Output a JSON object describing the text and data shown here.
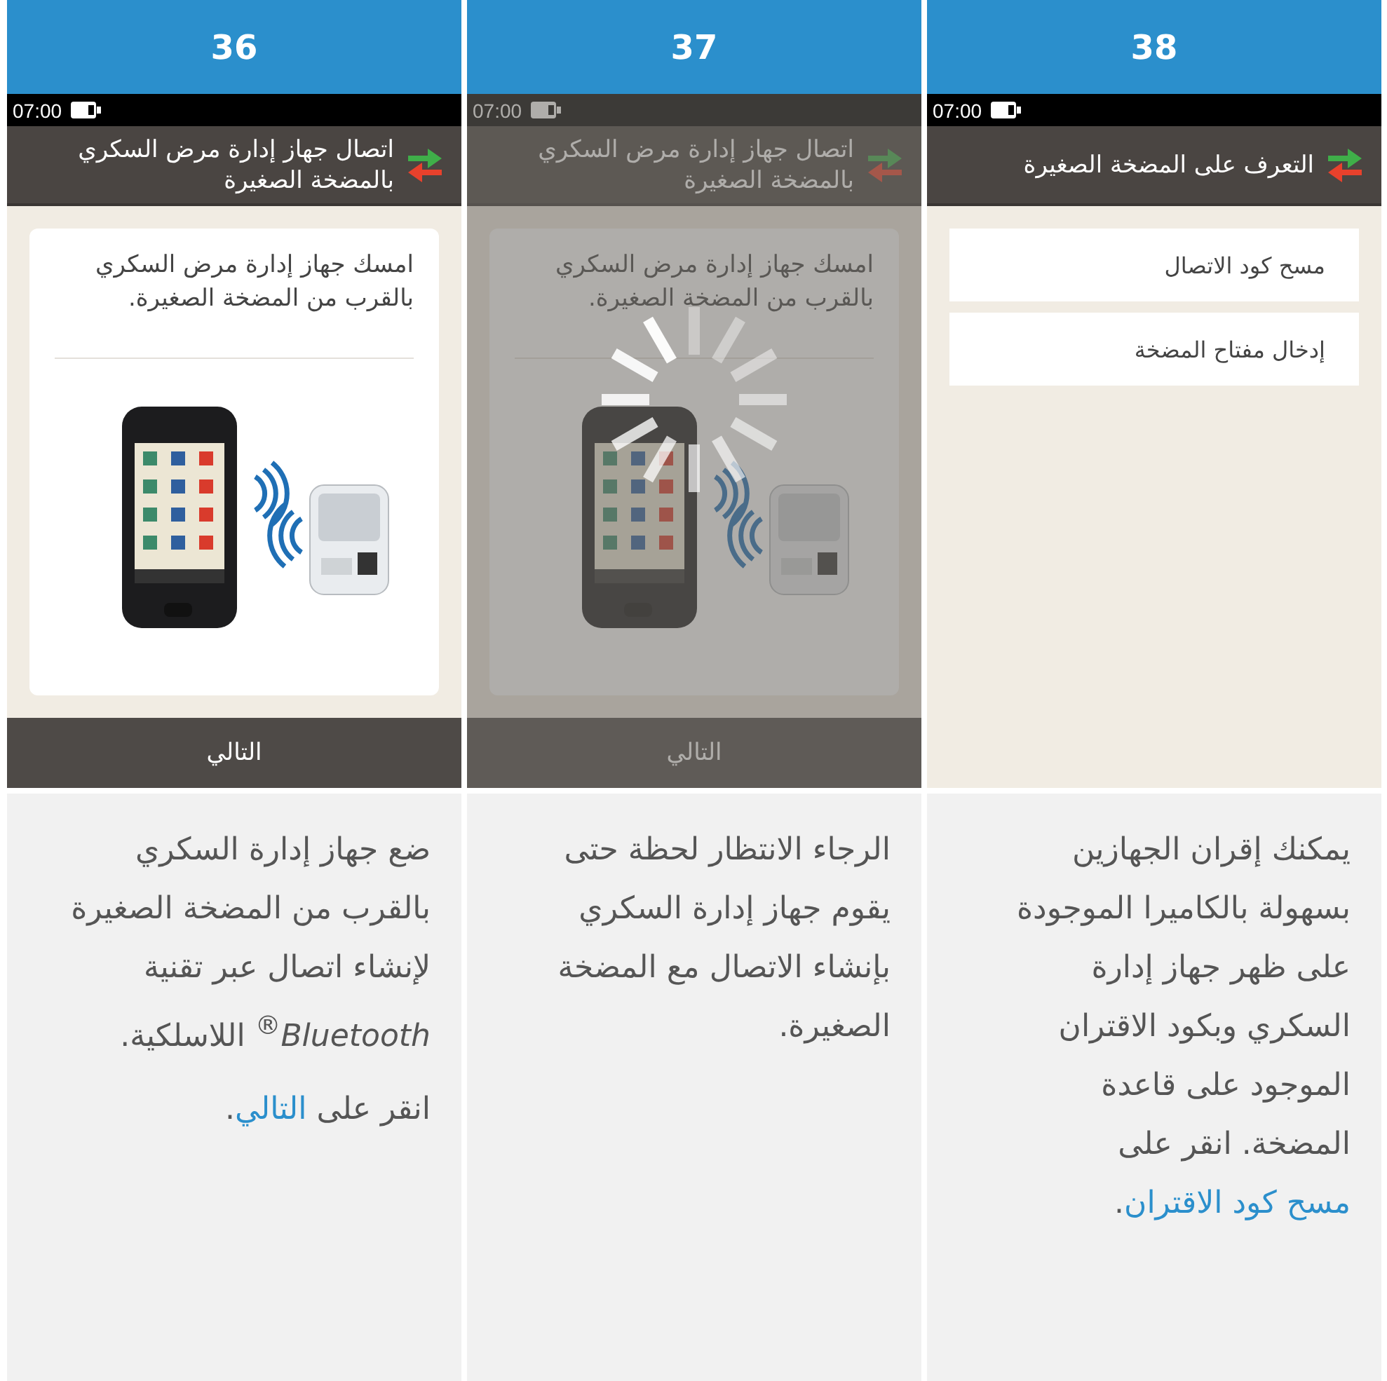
{
  "panels": [
    {
      "number": "38",
      "screen": {
        "time": "07:00",
        "title": "التعرف على المضخة الصغيرة",
        "kind": "menu",
        "busy": false,
        "menu_items": [
          "مسح كود الاتصال",
          "إدخال مفتاح المضخة"
        ]
      },
      "description": [
        [
          {
            "kind": "plain",
            "text": "يمكنك إقران الجهازين بسهولة بالكاميرا الموجودة على ظهر جهاز إدارة السكري وبكود الاقتران الموجود على قاعدة المضخة. انقر على "
          },
          {
            "kind": "link",
            "text": "مسح كود الاقتران"
          },
          {
            "kind": "plain",
            "text": "."
          }
        ]
      ]
    },
    {
      "number": "37",
      "screen": {
        "time": "07:00",
        "title": "اتصال جهاز إدارة مرض السكري بالمضخة الصغيرة",
        "kind": "instruction",
        "busy": true,
        "card_text": "امسك جهاز إدارة مرض السكري بالقرب من المضخة الصغيرة.",
        "next_button": "التالي"
      },
      "description": [
        [
          {
            "kind": "plain",
            "text": "الرجاء الانتظار لحظة حتى يقوم جهاز إدارة السكري بإنشاء الاتصال مع المضخة الصغيرة."
          }
        ]
      ]
    },
    {
      "number": "36",
      "screen": {
        "time": "07:00",
        "title": "اتصال جهاز إدارة مرض السكري بالمضخة الصغيرة",
        "kind": "instruction",
        "busy": false,
        "card_text": "امسك جهاز إدارة مرض السكري بالقرب من المضخة الصغيرة.",
        "next_button": "التالي"
      },
      "description": [
        [
          {
            "kind": "plain",
            "text": "ضع جهاز إدارة السكري بالقرب من المضخة الصغيرة لإنشاء اتصال عبر تقنية *Bluetooth*$^{®}$ اللاسلكية."
          }
        ],
        [
          {
            "kind": "plain",
            "text": "انقر على "
          },
          {
            "kind": "link",
            "text": "التالي"
          },
          {
            "kind": "plain",
            "text": "."
          }
        ]
      ]
    }
  ]
}
